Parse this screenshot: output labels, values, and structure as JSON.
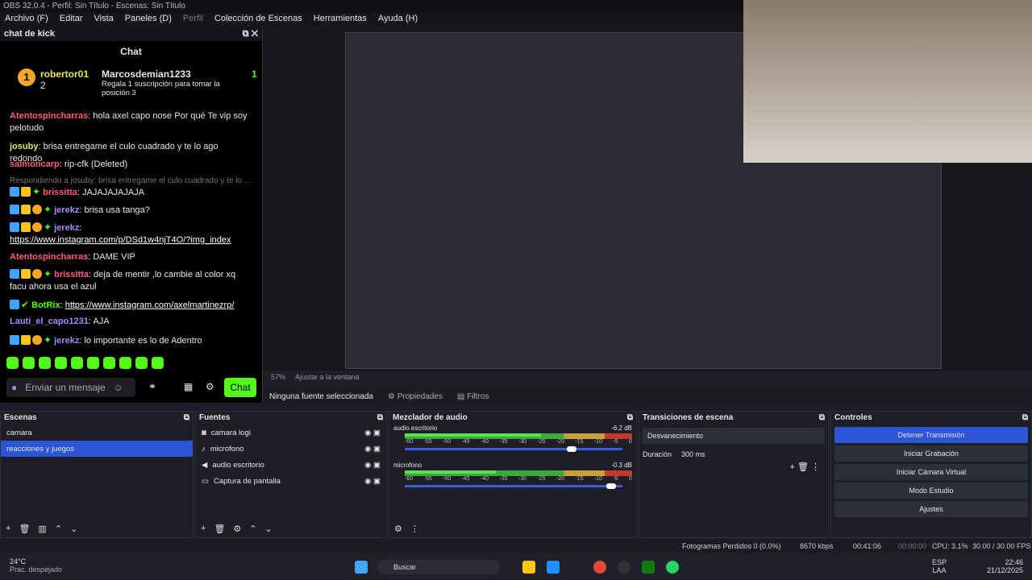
{
  "titlebar": "OBS 32.0.4 - Perfil: Sin Título - Escenas: Sin Título",
  "menu": [
    "Archivo (F)",
    "Editar",
    "Vista",
    "Paneles (D)",
    "Perfil",
    "Colección de Escenas",
    "Herramientas",
    "Ayuda (H)"
  ],
  "chat": {
    "dock_title": "chat de kick",
    "title": "Chat",
    "gifter": "robertor01",
    "gifter_count": "2",
    "gift_user": "Marcosdemian1233",
    "gift_num": "1",
    "gift_text": "Regala 1 suscripción para tomar la posición 3",
    "messages": [
      {
        "user": "Atentospincharras",
        "text": "hola axel capo nose Por qué Te vip soy pelotudo"
      },
      {
        "user": "josuby",
        "text": "brisa entregame el culo cuadrado y te lo ago redondo"
      },
      {
        "user": "salmoncarp",
        "text": "rip-cfk (Deleted)"
      },
      {
        "user": "",
        "text": "Respondiendo a josuby: brisa entregame el culo cuadrado y te lo ..."
      },
      {
        "user": "brissitta",
        "text": "JAJAJAJAJAJA"
      },
      {
        "user": "jerekz",
        "text": "brisa usa tanga?"
      },
      {
        "user": "jerekz",
        "text": "",
        "link": "https://www.instagram.com/p/DSd1w4njT4O/?img_index"
      },
      {
        "user": "Atentospincharras",
        "text": "DAME VIP"
      },
      {
        "user": "brissitta",
        "text": "deja de mentir ,lo cambie al color xq facu ahora usa el azul"
      },
      {
        "user": "BotRix",
        "text": "",
        "link": "https://www.instagram.com/axelmartinezrp/"
      },
      {
        "user": "Lauti_el_capo1231",
        "text": "AJA"
      },
      {
        "user": "jerekz",
        "text": "lo importante es lo de Adentro"
      }
    ],
    "input_placeholder": "Enviar un mensaje",
    "send": "Chat"
  },
  "zoom": "57%",
  "fit": "Ajustar a la ventana",
  "no_source": "Ninguna fuente seleccionada",
  "props": "Propiedades",
  "filters": "Filtros",
  "scenes": {
    "title": "Escenas",
    "items": [
      "camara",
      "reacciones y juegos"
    ]
  },
  "sources": {
    "title": "Fuentes",
    "items": [
      "camara logi",
      "microfono",
      "audio escritorio",
      "Captura de pantalla"
    ]
  },
  "mixer": {
    "title": "Mezclador de audio",
    "tracks": [
      {
        "name": "audio escritorio",
        "db": "-6.2 dB",
        "level": 0.6,
        "vol": 0.78
      },
      {
        "name": "microfono",
        "db": "-0.3 dB",
        "level": 0.4,
        "vol": 0.97
      }
    ],
    "scale": [
      "-60",
      "-55",
      "-50",
      "-45",
      "-40",
      "-35",
      "-30",
      "-25",
      "-20",
      "-15",
      "-10",
      "-5",
      "0"
    ]
  },
  "transitions": {
    "title": "Transiciones de escena",
    "value": "Desvanecimiento",
    "duration_label": "Duración",
    "duration": "300 ms"
  },
  "controls": {
    "title": "Controles",
    "buttons": [
      "Detener Transmisión",
      "Iniciar Grabación",
      "Iniciar Cámara Virtual",
      "Modo Estudio",
      "Ajustes"
    ]
  },
  "status": {
    "dropped": "Fotogramas Perdidos 0 (0.0%)",
    "kbps": "8670 kbps",
    "stream_time": "00:41:06",
    "rec_time": "00:00:00",
    "cpu": "CPU: 3.1%",
    "fps": "30.00 / 30.00 FPS"
  },
  "taskbar": {
    "temp": "24°C",
    "weather": "Prac. despejado",
    "search": "Buscar",
    "lang": "ESP",
    "layout": "LAA",
    "time": "22:46",
    "date": "21/12/2025"
  }
}
